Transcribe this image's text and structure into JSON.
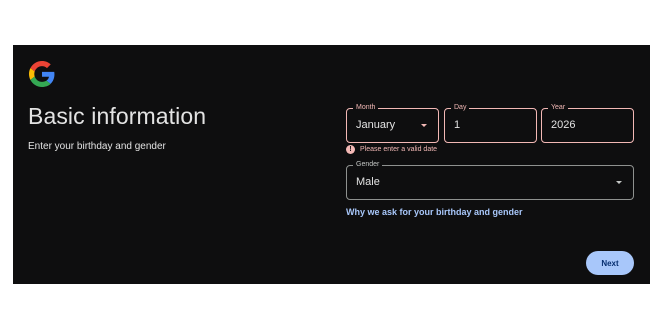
{
  "brand": {
    "logo_icon": "google-g-logo-icon"
  },
  "page": {
    "title": "Basic information",
    "subtitle": "Enter your birthday and gender"
  },
  "birthday": {
    "month": {
      "label": "Month",
      "value": "January"
    },
    "day": {
      "label": "Day",
      "value": "1"
    },
    "year": {
      "label": "Year",
      "value": "2026"
    },
    "error_text": "Please enter a valid date"
  },
  "gender": {
    "label": "Gender",
    "value": "Male"
  },
  "links": {
    "why_text": "Why we ask for your birthday and gender"
  },
  "actions": {
    "next_label": "Next"
  },
  "colors": {
    "background": "#0e0e0f",
    "error": "#f2b8b5",
    "link": "#a8c7fa",
    "button": "#a8c7fa"
  }
}
